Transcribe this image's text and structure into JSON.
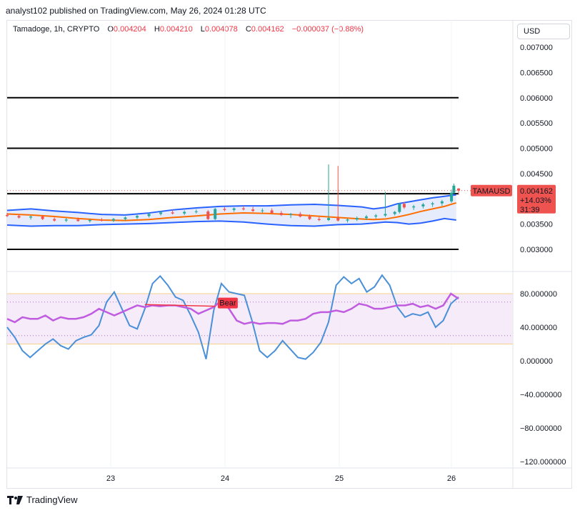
{
  "publisher_line": "analyst102 published on TradingView.com, May 26, 2024 01:28 UTC",
  "legend": {
    "title": "Tamadoge, 1h, CRYPTO",
    "open_label": "O",
    "open": "0.004204",
    "high_label": "H",
    "high": "0.004210",
    "low_label": "L",
    "low": "0.004078",
    "close_label": "C",
    "close": "0.004162",
    "change": "−0.000037 (−0.88%)"
  },
  "currency_button": "USD",
  "price_tag": {
    "symbol": "TAMAUSD",
    "price": "0.004162",
    "change": "+14.03%",
    "countdown": "31:39"
  },
  "stoch_tag": "Bear",
  "brand": "TradingView",
  "colors": {
    "candle_up": "#26a69a",
    "candle_down": "#ef5350",
    "band": "#2962ff",
    "basis": "#ff6d00",
    "band_fill": "#e3eafc",
    "k_line": "#4a90d9",
    "d_line": "#c05ce0",
    "bear": "#f23645",
    "rsi_fill": "#f3e6f7",
    "tag_red": "#ef5350"
  },
  "chart_data": [
    {
      "type": "candlestick",
      "title": "Tamadoge, 1h, CRYPTO",
      "x_tick_labels": [
        "23",
        "24",
        "25",
        "26"
      ],
      "y_tick_labels": [
        "0.007000",
        "0.006500",
        "0.006000",
        "0.005500",
        "0.005000",
        "0.004500",
        "0.004000",
        "0.003500",
        "0.003000"
      ],
      "ylim": [
        0.0026,
        0.0073
      ],
      "horizontal_levels": [
        0.006,
        0.005,
        0.0041,
        0.003
      ],
      "last_price": 0.004162,
      "overlays": [
        "bollinger_upper",
        "bollinger_basis",
        "bollinger_lower"
      ],
      "bollinger": {
        "upper": [
          [
            0,
            0.00377
          ],
          [
            10,
            0.0038
          ],
          [
            20,
            0.00376
          ],
          [
            30,
            0.00373
          ],
          [
            40,
            0.00369
          ],
          [
            50,
            0.00368
          ],
          [
            60,
            0.00372
          ],
          [
            70,
            0.00378
          ],
          [
            80,
            0.00382
          ],
          [
            90,
            0.00385
          ],
          [
            100,
            0.00386
          ],
          [
            110,
            0.00386
          ],
          [
            120,
            0.00388
          ],
          [
            130,
            0.00389
          ],
          [
            140,
            0.00387
          ],
          [
            150,
            0.00384
          ],
          [
            155,
            0.0038
          ],
          [
            160,
            0.00383
          ],
          [
            165,
            0.0039
          ],
          [
            170,
            0.00394
          ],
          [
            175,
            0.00398
          ],
          [
            180,
            0.00402
          ],
          [
            185,
            0.00405
          ],
          [
            190,
            0.00408
          ]
        ],
        "basis": [
          [
            0,
            0.0037
          ],
          [
            10,
            0.00368
          ],
          [
            20,
            0.00365
          ],
          [
            30,
            0.00361
          ],
          [
            40,
            0.00358
          ],
          [
            50,
            0.00357
          ],
          [
            60,
            0.00359
          ],
          [
            70,
            0.00363
          ],
          [
            80,
            0.00366
          ],
          [
            90,
            0.0037
          ],
          [
            100,
            0.00372
          ],
          [
            110,
            0.00371
          ],
          [
            120,
            0.00369
          ],
          [
            130,
            0.00366
          ],
          [
            140,
            0.00363
          ],
          [
            150,
            0.0036
          ],
          [
            155,
            0.00359
          ],
          [
            160,
            0.0036
          ],
          [
            165,
            0.00364
          ],
          [
            170,
            0.00369
          ],
          [
            175,
            0.00375
          ],
          [
            180,
            0.0038
          ],
          [
            185,
            0.00385
          ],
          [
            190,
            0.00392
          ]
        ],
        "lower": [
          [
            0,
            0.00348
          ],
          [
            10,
            0.00346
          ],
          [
            20,
            0.00347
          ],
          [
            30,
            0.00347
          ],
          [
            40,
            0.00349
          ],
          [
            50,
            0.0035
          ],
          [
            60,
            0.00351
          ],
          [
            70,
            0.00353
          ],
          [
            80,
            0.00355
          ],
          [
            90,
            0.00356
          ],
          [
            100,
            0.00354
          ],
          [
            110,
            0.0035
          ],
          [
            120,
            0.00347
          ],
          [
            130,
            0.00346
          ],
          [
            140,
            0.00349
          ],
          [
            150,
            0.0035
          ],
          [
            155,
            0.00352
          ],
          [
            160,
            0.00354
          ],
          [
            165,
            0.00353
          ],
          [
            170,
            0.0035
          ],
          [
            175,
            0.00352
          ],
          [
            180,
            0.00356
          ],
          [
            185,
            0.00361
          ],
          [
            190,
            0.00358
          ]
        ]
      },
      "candles": [
        [
          0,
          0.00368,
          0.00372,
          0.00364,
          0.00366
        ],
        [
          5,
          0.00366,
          0.00369,
          0.00361,
          0.00363
        ],
        [
          10,
          0.00363,
          0.00367,
          0.00359,
          0.00365
        ],
        [
          15,
          0.00365,
          0.00368,
          0.00358,
          0.0036
        ],
        [
          20,
          0.0036,
          0.00363,
          0.00355,
          0.00357
        ],
        [
          25,
          0.00357,
          0.00362,
          0.00354,
          0.00359
        ],
        [
          30,
          0.00359,
          0.00363,
          0.00355,
          0.00356
        ],
        [
          35,
          0.00356,
          0.0036,
          0.00353,
          0.00358
        ],
        [
          40,
          0.00358,
          0.00362,
          0.00355,
          0.00357
        ],
        [
          45,
          0.00357,
          0.00362,
          0.00354,
          0.0036
        ],
        [
          50,
          0.0036,
          0.00365,
          0.00357,
          0.00363
        ],
        [
          55,
          0.00363,
          0.00368,
          0.0036,
          0.00366
        ],
        [
          60,
          0.00366,
          0.00372,
          0.00363,
          0.0037
        ],
        [
          65,
          0.0037,
          0.00376,
          0.00367,
          0.00373
        ],
        [
          70,
          0.00373,
          0.00378,
          0.00369,
          0.00371
        ],
        [
          75,
          0.00371,
          0.00377,
          0.00368,
          0.00374
        ],
        [
          80,
          0.00374,
          0.00379,
          0.00371,
          0.00375
        ],
        [
          85,
          0.00375,
          0.00378,
          0.00358,
          0.0036
        ],
        [
          88,
          0.0036,
          0.00382,
          0.00358,
          0.0038
        ],
        [
          92,
          0.0038,
          0.00384,
          0.00375,
          0.00378
        ],
        [
          96,
          0.00378,
          0.00383,
          0.00374,
          0.00381
        ],
        [
          100,
          0.00381,
          0.00386,
          0.00377,
          0.00379
        ],
        [
          104,
          0.00379,
          0.00384,
          0.00374,
          0.00376
        ],
        [
          108,
          0.00376,
          0.00381,
          0.00372,
          0.00377
        ],
        [
          112,
          0.00377,
          0.00381,
          0.0037,
          0.00372
        ],
        [
          116,
          0.00372,
          0.00376,
          0.00366,
          0.00368
        ],
        [
          120,
          0.00368,
          0.00372,
          0.00362,
          0.0037
        ],
        [
          124,
          0.0037,
          0.00374,
          0.00363,
          0.00365
        ],
        [
          128,
          0.00365,
          0.00369,
          0.00358,
          0.0036
        ],
        [
          132,
          0.0036,
          0.00364,
          0.00356,
          0.00358
        ],
        [
          136,
          0.00358,
          0.00468,
          0.00356,
          0.00362
        ],
        [
          140,
          0.00362,
          0.00465,
          0.00355,
          0.00357
        ],
        [
          144,
          0.00357,
          0.00361,
          0.00353,
          0.00359
        ],
        [
          148,
          0.00359,
          0.00365,
          0.00356,
          0.00362
        ],
        [
          152,
          0.00362,
          0.00368,
          0.00358,
          0.00365
        ],
        [
          156,
          0.00365,
          0.0037,
          0.00361,
          0.00367
        ],
        [
          160,
          0.00367,
          0.00414,
          0.00364,
          0.0037
        ],
        [
          164,
          0.0037,
          0.00376,
          0.00367,
          0.00374
        ],
        [
          166,
          0.00374,
          0.00392,
          0.00371,
          0.0039
        ],
        [
          168,
          0.0039,
          0.00394,
          0.0038,
          0.00383
        ],
        [
          172,
          0.00383,
          0.00388,
          0.00378,
          0.00385
        ],
        [
          176,
          0.00385,
          0.00392,
          0.00381,
          0.00389
        ],
        [
          180,
          0.00389,
          0.00394,
          0.00384,
          0.00391
        ],
        [
          184,
          0.00391,
          0.00398,
          0.00386,
          0.00395
        ],
        [
          188,
          0.00395,
          0.00418,
          0.00392,
          0.00412
        ],
        [
          189,
          0.00412,
          0.0043,
          0.00409,
          0.00426
        ],
        [
          191,
          0.004204,
          0.00421,
          0.004078,
          0.004162
        ]
      ]
    },
    {
      "type": "line",
      "title": "Stochastic RSI",
      "y_tick_labels": [
        "80.000000",
        "40.000000",
        "0.000000",
        "−40.000000",
        "−80.000000",
        "−120.000000"
      ],
      "ylim": [
        -130,
        115
      ],
      "band": [
        20,
        80
      ],
      "dotted_levels": [
        70,
        30
      ],
      "series": [
        {
          "role": "k",
          "values": [
            [
              0,
              40
            ],
            [
              4,
              28
            ],
            [
              8,
              12
            ],
            [
              12,
              4
            ],
            [
              16,
              12
            ],
            [
              20,
              20
            ],
            [
              24,
              26
            ],
            [
              28,
              18
            ],
            [
              32,
              14
            ],
            [
              36,
              24
            ],
            [
              40,
              28
            ],
            [
              44,
              31
            ],
            [
              48,
              42
            ],
            [
              52,
              70
            ],
            [
              56,
              82
            ],
            [
              60,
              62
            ],
            [
              64,
              42
            ],
            [
              68,
              38
            ],
            [
              72,
              62
            ],
            [
              76,
              92
            ],
            [
              80,
              101
            ],
            [
              84,
              90
            ],
            [
              88,
              76
            ],
            [
              92,
              72
            ],
            [
              96,
              54
            ],
            [
              100,
              34
            ],
            [
              104,
              2
            ],
            [
              108,
              60
            ],
            [
              112,
              92
            ],
            [
              116,
              82
            ],
            [
              120,
              80
            ],
            [
              124,
              78
            ],
            [
              128,
              48
            ],
            [
              132,
              12
            ],
            [
              136,
              4
            ],
            [
              140,
              12
            ],
            [
              144,
              24
            ],
            [
              148,
              14
            ],
            [
              152,
              4
            ],
            [
              156,
              2
            ],
            [
              160,
              10
            ],
            [
              164,
              22
            ],
            [
              168,
              46
            ],
            [
              172,
              90
            ],
            [
              176,
              100
            ],
            [
              180,
              92
            ],
            [
              184,
              98
            ],
            [
              188,
              82
            ],
            [
              192,
              88
            ],
            [
              196,
              102
            ],
            [
              200,
              90
            ],
            [
              204,
              64
            ],
            [
              208,
              52
            ],
            [
              212,
              56
            ],
            [
              216,
              54
            ],
            [
              220,
              58
            ],
            [
              224,
              40
            ],
            [
              228,
              48
            ],
            [
              232,
              68
            ],
            [
              236,
              76
            ]
          ]
        },
        {
          "role": "d",
          "values": [
            [
              0,
              50
            ],
            [
              4,
              46
            ],
            [
              8,
              52
            ],
            [
              12,
              50
            ],
            [
              16,
              50
            ],
            [
              20,
              54
            ],
            [
              24,
              48
            ],
            [
              28,
              52
            ],
            [
              32,
              50
            ],
            [
              36,
              50
            ],
            [
              40,
              52
            ],
            [
              44,
              56
            ],
            [
              48,
              62
            ],
            [
              52,
              58
            ],
            [
              56,
              54
            ],
            [
              60,
              58
            ],
            [
              64,
              62
            ],
            [
              68,
              66
            ],
            [
              72,
              64
            ],
            [
              76,
              66
            ],
            [
              80,
              65
            ],
            [
              84,
              66
            ],
            [
              88,
              66
            ],
            [
              92,
              64
            ],
            [
              96,
              62
            ],
            [
              100,
              56
            ],
            [
              104,
              60
            ],
            [
              108,
              64
            ],
            [
              112,
              72
            ],
            [
              116,
              62
            ],
            [
              120,
              48
            ],
            [
              124,
              44
            ],
            [
              128,
              46
            ],
            [
              132,
              44
            ],
            [
              136,
              45
            ],
            [
              140,
              45
            ],
            [
              144,
              44
            ],
            [
              148,
              48
            ],
            [
              152,
              48
            ],
            [
              156,
              50
            ],
            [
              160,
              56
            ],
            [
              164,
              58
            ],
            [
              168,
              58
            ],
            [
              172,
              60
            ],
            [
              176,
              58
            ],
            [
              180,
              62
            ],
            [
              184,
              68
            ],
            [
              188,
              66
            ],
            [
              192,
              62
            ],
            [
              196,
              62
            ],
            [
              200,
              64
            ],
            [
              204,
              66
            ],
            [
              208,
              66
            ],
            [
              212,
              68
            ],
            [
              216,
              64
            ],
            [
              220,
              66
            ],
            [
              224,
              62
            ],
            [
              228,
              66
            ],
            [
              232,
              80
            ],
            [
              236,
              74
            ]
          ]
        }
      ],
      "divergence": [
        [
          72,
          67
        ],
        [
          109,
          65
        ]
      ]
    }
  ]
}
